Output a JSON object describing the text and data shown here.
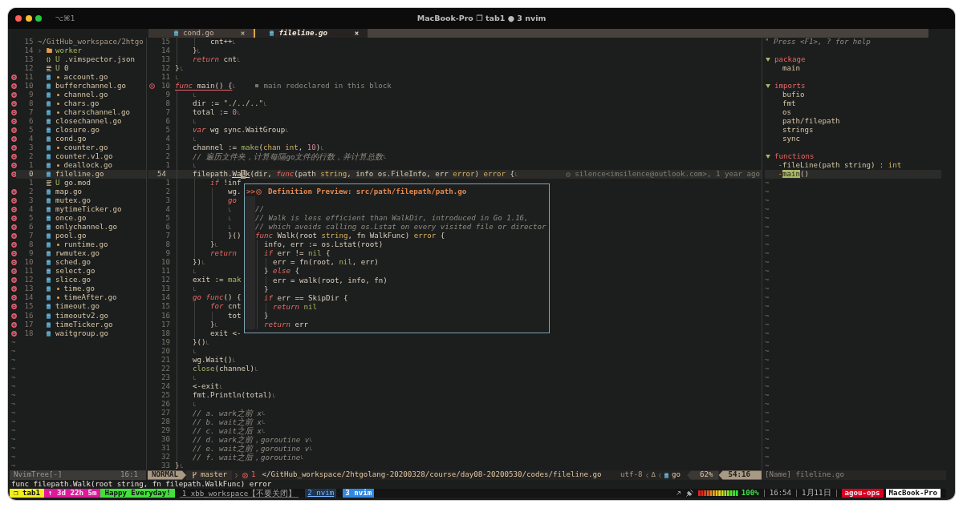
{
  "window": {
    "shortcut": "⌥⌘1",
    "title": "MacBook-Pro ❐ tab1 ● 3 nvim"
  },
  "tabline": {
    "tabs": [
      {
        "label": "cond.go",
        "selected": false
      },
      {
        "label": "fileline.go",
        "selected": true
      }
    ]
  },
  "file_tree": {
    "root": {
      "number": "15",
      "path": "~/GitHub_workspace/2htgo"
    },
    "items": [
      {
        "number": "14",
        "kind": "folder",
        "name": "worker",
        "expanded": false,
        "modified": false,
        "error": false,
        "selected": false
      },
      {
        "number": "13",
        "kind": "json",
        "git": "U",
        "name": ".vimspector.json",
        "modified": false,
        "error": false,
        "selected": false
      },
      {
        "number": "12",
        "kind": "text",
        "git": "U",
        "name": "0",
        "modified": false,
        "error": false,
        "selected": false
      },
      {
        "number": "11",
        "kind": "go",
        "name": "account.go",
        "modified": true,
        "error": true,
        "selected": false
      },
      {
        "number": "10",
        "kind": "go",
        "name": "bufferchannel.go",
        "modified": false,
        "error": true,
        "selected": false
      },
      {
        "number": "9",
        "kind": "go",
        "name": "channel.go",
        "modified": true,
        "error": true,
        "selected": false
      },
      {
        "number": "8",
        "kind": "go",
        "name": "chars.go",
        "modified": true,
        "error": true,
        "selected": false
      },
      {
        "number": "7",
        "kind": "go",
        "name": "charschannel.go",
        "modified": true,
        "error": true,
        "selected": false
      },
      {
        "number": "6",
        "kind": "go",
        "name": "closechannel.go",
        "modified": false,
        "error": true,
        "selected": false
      },
      {
        "number": "5",
        "kind": "go",
        "name": "closure.go",
        "modified": false,
        "error": true,
        "selected": false
      },
      {
        "number": "4",
        "kind": "go",
        "name": "cond.go",
        "modified": false,
        "error": true,
        "selected": false
      },
      {
        "number": "3",
        "kind": "go",
        "name": "counter.go",
        "modified": true,
        "error": true,
        "selected": false
      },
      {
        "number": "2",
        "kind": "go",
        "name": "counter.v1.go",
        "modified": false,
        "error": true,
        "selected": false
      },
      {
        "number": "1",
        "kind": "go",
        "name": "deallock.go",
        "modified": true,
        "error": true,
        "selected": false
      },
      {
        "number": "0",
        "kind": "go",
        "name": "fileline.go",
        "modified": false,
        "error": true,
        "selected": true
      },
      {
        "number": "1",
        "kind": "text",
        "git": "U",
        "name": "go.mod",
        "modified": false,
        "error": false,
        "selected": false
      },
      {
        "number": "2",
        "kind": "go",
        "name": "map.go",
        "modified": false,
        "error": true,
        "selected": false
      },
      {
        "number": "3",
        "kind": "go",
        "name": "mutex.go",
        "modified": false,
        "error": true,
        "selected": false
      },
      {
        "number": "4",
        "kind": "go",
        "name": "mytimeTicker.go",
        "modified": false,
        "error": true,
        "selected": false
      },
      {
        "number": "5",
        "kind": "go",
        "name": "once.go",
        "modified": false,
        "error": true,
        "selected": false
      },
      {
        "number": "6",
        "kind": "go",
        "name": "onlychannel.go",
        "modified": false,
        "error": true,
        "selected": false
      },
      {
        "number": "7",
        "kind": "go",
        "name": "pool.go",
        "modified": false,
        "error": true,
        "selected": false
      },
      {
        "number": "8",
        "kind": "go",
        "name": "runtime.go",
        "modified": true,
        "error": true,
        "selected": false
      },
      {
        "number": "9",
        "kind": "go",
        "name": "rwmutex.go",
        "modified": false,
        "error": true,
        "selected": false
      },
      {
        "number": "10",
        "kind": "go",
        "name": "sched.go",
        "modified": false,
        "error": true,
        "selected": false
      },
      {
        "number": "11",
        "kind": "go",
        "name": "select.go",
        "modified": false,
        "error": true,
        "selected": false
      },
      {
        "number": "12",
        "kind": "go",
        "name": "slice.go",
        "modified": false,
        "error": true,
        "selected": false
      },
      {
        "number": "13",
        "kind": "go",
        "name": "time.go",
        "modified": true,
        "error": true,
        "selected": false
      },
      {
        "number": "14",
        "kind": "go",
        "name": "timeAfter.go",
        "modified": true,
        "error": true,
        "selected": false
      },
      {
        "number": "15",
        "kind": "go",
        "name": "timeout.go",
        "modified": false,
        "error": true,
        "selected": false
      },
      {
        "number": "16",
        "kind": "go",
        "name": "timeoutv2.go",
        "modified": false,
        "error": true,
        "selected": false
      },
      {
        "number": "17",
        "kind": "go",
        "name": "timeTicker.go",
        "modified": false,
        "error": true,
        "selected": false
      },
      {
        "number": "18",
        "kind": "go",
        "name": "waitgroup.go",
        "modified": false,
        "error": true,
        "selected": false
      }
    ],
    "filler": [
      "~",
      "~",
      "~",
      "~",
      "~",
      "~",
      "~",
      "~",
      "~",
      "~",
      "~",
      "~",
      "~",
      "~",
      "~"
    ]
  },
  "editor": {
    "lines": [
      {
        "number": "15",
        "selected": false,
        "eol": true,
        "code": [
          {
            "text": "        cnt++",
            "kind": "plain"
          }
        ]
      },
      {
        "number": "14",
        "selected": false,
        "eol": true,
        "code": [
          {
            "text": "    }",
            "kind": "plain"
          }
        ]
      },
      {
        "number": "13",
        "selected": false,
        "eol": true,
        "code": [
          {
            "text": "    return",
            "kind": "keyword"
          },
          {
            "text": " cnt",
            "kind": "plain"
          }
        ]
      },
      {
        "number": "12",
        "selected": false,
        "eol": true,
        "code": [
          {
            "text": "}",
            "kind": "plain"
          }
        ]
      },
      {
        "number": "11",
        "selected": false,
        "eol": true
      },
      {
        "number": "10",
        "selected": false,
        "eol": true,
        "code": [
          {
            "text": "func",
            "kind": "keyword"
          },
          {
            "text": " main() {",
            "kind": "plain"
          }
        ],
        "diagnostic": {
          "kind": "error",
          "message": "main redeclared in this block"
        }
      },
      {
        "number": "9",
        "selected": false,
        "eol": true
      },
      {
        "number": "8",
        "selected": false,
        "eol": true,
        "code": [
          {
            "text": "    dir := ",
            "kind": "plain"
          },
          {
            "text": "\"./../..\"",
            "kind": "string"
          }
        ]
      },
      {
        "number": "7",
        "selected": false,
        "eol": true,
        "code": [
          {
            "text": "    total := ",
            "kind": "plain"
          },
          {
            "text": "0",
            "kind": "number"
          }
        ]
      },
      {
        "number": "6",
        "selected": false,
        "eol": true
      },
      {
        "number": "5",
        "selected": false,
        "eol": true,
        "code": [
          {
            "text": "    var",
            "kind": "keyword"
          },
          {
            "text": " wg sync.WaitGroup",
            "kind": "plain"
          }
        ]
      },
      {
        "number": "4",
        "selected": false,
        "eol": true
      },
      {
        "number": "3",
        "selected": false,
        "eol": true,
        "code": [
          {
            "text": "    channel := ",
            "kind": "plain"
          },
          {
            "text": "make",
            "kind": "builtin"
          },
          {
            "text": "(",
            "kind": "plain"
          },
          {
            "text": "chan",
            "kind": "type"
          },
          {
            "text": " int",
            "kind": "type"
          },
          {
            "text": ", ",
            "kind": "plain"
          },
          {
            "text": "10",
            "kind": "number"
          },
          {
            "text": ")",
            "kind": "plain"
          }
        ]
      },
      {
        "number": "2",
        "selected": false,
        "eol": true,
        "code": [
          {
            "text": "    // 遍历文件夹，计算每隔go文件的行数，并计算总数",
            "kind": "comment"
          }
        ]
      },
      {
        "number": "1",
        "selected": false,
        "eol": true
      },
      {
        "number": "54",
        "selected": true,
        "eol": true,
        "code": [
          {
            "text": "    filepath.",
            "kind": "plain"
          },
          {
            "text": "Wa",
            "kind": "word"
          },
          {
            "text": "l",
            "kind": "cursor"
          },
          {
            "text": "k",
            "kind": "word"
          },
          {
            "text": "(dir, ",
            "kind": "plain"
          },
          {
            "text": "func",
            "kind": "keyword"
          },
          {
            "text": "(path ",
            "kind": "plain"
          },
          {
            "text": "string",
            "kind": "type"
          },
          {
            "text": ", info os.FileInfo, err ",
            "kind": "plain"
          },
          {
            "text": "error",
            "kind": "type"
          },
          {
            "text": ") ",
            "kind": "plain"
          },
          {
            "text": "error",
            "kind": "type"
          },
          {
            "text": " {",
            "kind": "plain"
          }
        ],
        "blame": "silence<imsilence@outlook.com>, 1 year ago"
      },
      {
        "number": "1",
        "selected": false,
        "eol": false,
        "code": [
          {
            "text": "        if",
            "kind": "keyword"
          },
          {
            "text": " !inf",
            "kind": "plain"
          }
        ]
      },
      {
        "number": "2",
        "selected": false,
        "eol": false,
        "code": [
          {
            "text": "            wg.",
            "kind": "plain"
          }
        ]
      },
      {
        "number": "3",
        "selected": false,
        "eol": false,
        "code": [
          {
            "text": "            go",
            "kind": "keyword"
          }
        ]
      },
      {
        "number": "4",
        "selected": false,
        "eol": true
      },
      {
        "number": "5",
        "selected": false,
        "eol": true
      },
      {
        "number": "6",
        "selected": false,
        "eol": true
      },
      {
        "number": "7",
        "selected": false,
        "eol": false,
        "code": [
          {
            "text": "            }()",
            "kind": "plain"
          }
        ]
      },
      {
        "number": "8",
        "selected": false,
        "eol": true,
        "code": [
          {
            "text": "        }",
            "kind": "plain"
          }
        ]
      },
      {
        "number": "9",
        "selected": false,
        "eol": false,
        "code": [
          {
            "text": "        return",
            "kind": "keyword"
          }
        ]
      },
      {
        "number": "10",
        "selected": false,
        "eol": true,
        "code": [
          {
            "text": "    })",
            "kind": "plain"
          }
        ]
      },
      {
        "number": "11",
        "selected": false,
        "eol": true
      },
      {
        "number": "12",
        "selected": false,
        "eol": false,
        "code": [
          {
            "text": "    exit := ",
            "kind": "plain"
          },
          {
            "text": "mak",
            "kind": "builtin"
          }
        ]
      },
      {
        "number": "13",
        "selected": false,
        "eol": true
      },
      {
        "number": "14",
        "selected": false,
        "eol": false,
        "code": [
          {
            "text": "    go",
            "kind": "keyword"
          },
          {
            "text": " func",
            "kind": "keyword"
          },
          {
            "text": "() {",
            "kind": "plain"
          }
        ]
      },
      {
        "number": "15",
        "selected": false,
        "eol": false,
        "code": [
          {
            "text": "        for",
            "kind": "keyword"
          },
          {
            "text": " cnt",
            "kind": "plain"
          }
        ]
      },
      {
        "number": "16",
        "selected": false,
        "eol": false,
        "code": [
          {
            "text": "            tot",
            "kind": "plain"
          }
        ]
      },
      {
        "number": "17",
        "selected": false,
        "eol": true,
        "code": [
          {
            "text": "        }",
            "kind": "plain"
          }
        ]
      },
      {
        "number": "18",
        "selected": false,
        "eol": false,
        "code": [
          {
            "text": "        exit <-",
            "kind": "plain"
          }
        ]
      },
      {
        "number": "19",
        "selected": false,
        "eol": true,
        "code": [
          {
            "text": "    }()",
            "kind": "plain"
          }
        ]
      },
      {
        "number": "20",
        "selected": false,
        "eol": true
      },
      {
        "number": "21",
        "selected": false,
        "eol": true,
        "code": [
          {
            "text": "    wg.Wait()",
            "kind": "plain"
          }
        ]
      },
      {
        "number": "22",
        "selected": false,
        "eol": true,
        "code": [
          {
            "text": "    close",
            "kind": "builtin"
          },
          {
            "text": "(channel)",
            "kind": "plain"
          }
        ]
      },
      {
        "number": "23",
        "selected": false,
        "eol": true
      },
      {
        "number": "24",
        "selected": false,
        "eol": true,
        "code": [
          {
            "text": "    <-exit",
            "kind": "plain"
          }
        ]
      },
      {
        "number": "25",
        "selected": false,
        "eol": true,
        "code": [
          {
            "text": "    fmt.Println(total)",
            "kind": "plain"
          }
        ]
      },
      {
        "number": "26",
        "selected": false,
        "eol": true
      },
      {
        "number": "27",
        "selected": false,
        "eol": true,
        "code": [
          {
            "text": "    // a. wark之前 x",
            "kind": "comment"
          }
        ]
      },
      {
        "number": "28",
        "selected": false,
        "eol": true,
        "code": [
          {
            "text": "    // b. wait之前 x",
            "kind": "comment"
          }
        ]
      },
      {
        "number": "29",
        "selected": false,
        "eol": true,
        "code": [
          {
            "text": "    // c. wait之后 x",
            "kind": "comment"
          }
        ]
      },
      {
        "number": "30",
        "selected": false,
        "eol": true,
        "code": [
          {
            "text": "    // d. wark之前，goroutine v",
            "kind": "comment"
          }
        ]
      },
      {
        "number": "31",
        "selected": false,
        "eol": true,
        "code": [
          {
            "text": "    // e. wait之前，goroutine v",
            "kind": "comment"
          }
        ]
      },
      {
        "number": "32",
        "selected": false,
        "eol": true,
        "code": [
          {
            "text": "    // f. wait之后，goroutine",
            "kind": "comment"
          }
        ]
      },
      {
        "number": "33",
        "selected": false,
        "eol": true,
        "code": [
          {
            "text": "}",
            "kind": "plain"
          }
        ]
      }
    ],
    "popup": {
      "prefix": ">>",
      "title": "Definition Preview: src/path/filepath/path.go",
      "lines": [
        {
          "code": [
            {
              "text": "//",
              "kind": "comment"
            }
          ]
        },
        {
          "code": [
            {
              "text": "// Walk is less efficient than WalkDir, introduced in Go 1.16,",
              "kind": "comment"
            }
          ]
        },
        {
          "code": [
            {
              "text": "// which avoids calling os.Lstat on every visited file or director",
              "kind": "comment"
            }
          ]
        },
        {
          "code": [
            {
              "text": "func",
              "kind": "keyword"
            },
            {
              "text": " Walk(root ",
              "kind": "plain"
            },
            {
              "text": "string",
              "kind": "type"
            },
            {
              "text": ", fn WalkFunc) ",
              "kind": "plain"
            },
            {
              "text": "error",
              "kind": "type"
            },
            {
              "text": " {",
              "kind": "plain"
            }
          ]
        },
        {
          "code": [
            {
              "text": "  info, err := os.Lstat(root)",
              "kind": "plain"
            }
          ]
        },
        {
          "code": [
            {
              "text": "  if",
              "kind": "keyword"
            },
            {
              "text": " err != ",
              "kind": "plain"
            },
            {
              "text": "nil",
              "kind": "builtin"
            },
            {
              "text": " {",
              "kind": "plain"
            }
          ]
        },
        {
          "code": [
            {
              "text": "    err = fn(root, ",
              "kind": "plain"
            },
            {
              "text": "nil",
              "kind": "builtin"
            },
            {
              "text": ", err)",
              "kind": "plain"
            }
          ]
        },
        {
          "code": [
            {
              "text": "  } ",
              "kind": "plain"
            },
            {
              "text": "else",
              "kind": "keyword"
            },
            {
              "text": " {",
              "kind": "plain"
            }
          ]
        },
        {
          "code": [
            {
              "text": "    err = walk(root, info, fn)",
              "kind": "plain"
            }
          ]
        },
        {
          "code": [
            {
              "text": "  }",
              "kind": "plain"
            }
          ]
        },
        {
          "code": [
            {
              "text": "  if",
              "kind": "keyword"
            },
            {
              "text": " err == SkipDir {",
              "kind": "plain"
            }
          ]
        },
        {
          "code": [
            {
              "text": "    return",
              "kind": "keyword"
            },
            {
              "text": " nil",
              "kind": "builtin"
            }
          ]
        },
        {
          "code": [
            {
              "text": "  }",
              "kind": "plain"
            }
          ]
        },
        {
          "code": [
            {
              "text": "  return",
              "kind": "keyword"
            },
            {
              "text": " err",
              "kind": "plain"
            }
          ]
        }
      ]
    }
  },
  "tagbar": {
    "help": "\" Press <F1>, ? for help",
    "groups": [
      {
        "name": "package",
        "expanded": true,
        "items": [
          {
            "name": "main",
            "selected": false
          }
        ]
      },
      {
        "name": "imports",
        "expanded": true,
        "items": [
          {
            "name": "bufio",
            "selected": false
          },
          {
            "name": "fmt",
            "selected": false
          },
          {
            "name": "os",
            "selected": false
          },
          {
            "name": "path/filepath",
            "selected": false
          },
          {
            "name": "strings",
            "selected": false
          },
          {
            "name": "sync",
            "selected": false
          }
        ]
      },
      {
        "name": "functions",
        "expanded": true,
        "items": [
          {
            "marker": "-",
            "name": "fileLine",
            "detail": "(path string) : ",
            "type": "int",
            "selected": false
          },
          {
            "marker": "-",
            "name": "main",
            "detail": "()",
            "selected": true
          }
        ]
      }
    ],
    "filler": [
      "~",
      "~",
      "~",
      "~",
      "~",
      "~",
      "~",
      "~",
      "~",
      "~",
      "~",
      "~",
      "~",
      "~",
      "~",
      "~",
      "~",
      "~",
      "~",
      "~",
      "~",
      "~",
      "~",
      "~",
      "~",
      "~",
      "~",
      "~",
      "~",
      "~",
      "~",
      "~",
      "~"
    ]
  },
  "status_line": {
    "tree": {
      "name": "NvimTree[-]",
      "position": "16:1"
    },
    "editor": {
      "mode": "NORMAL",
      "branch": "master",
      "errors": "1",
      "path": "</GitHub_workspace/2htgolang-20200328/course/day08-20200530/codes/fileline.go",
      "encoding": "utf-8",
      "fileformat": "Δ",
      "filetype": "go",
      "percent": "62%",
      "position": "54:16"
    },
    "tagbar": "[Name] fileline.go"
  },
  "command_line": "func filepath.Walk(root string, fn filepath.WalkFunc) error",
  "tmux": {
    "segments": [
      {
        "text": "❐ tab1",
        "color": "#f2ee1e"
      },
      {
        "text": "↑ 3d 22h 5m",
        "color": "#e2189c"
      },
      {
        "text": "Happy Everyday!",
        "color": "#41e03a"
      }
    ],
    "windows": [
      {
        "label": "1 xbb_workspace【不要关闭】",
        "selected": false,
        "last": false
      },
      {
        "label": "2 nvim",
        "selected": false,
        "last": true
      },
      {
        "label": "3 nvim",
        "selected": true,
        "last": false
      }
    ],
    "battery": "100%",
    "time": "16:54",
    "date": "1月11日",
    "user": {
      "text": "agou-ops",
      "color": "#d7001f"
    },
    "host": {
      "text": "MacBook-Pro",
      "color": "#ffffff"
    }
  }
}
